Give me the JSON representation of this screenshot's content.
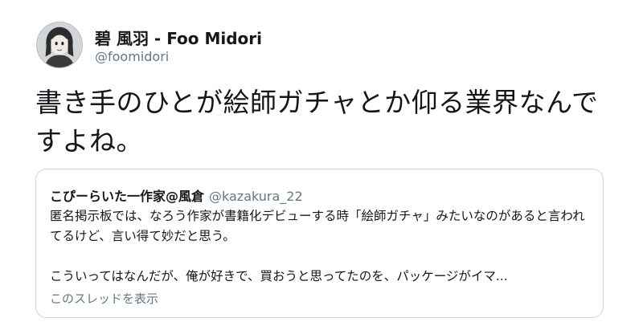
{
  "author": {
    "display_name": "碧 風羽 - Foo Midori",
    "handle": "@foomidori"
  },
  "tweet": {
    "text": "書き手のひとが絵師ガチャとか仰る業界なんですよね。"
  },
  "quoted_tweet": {
    "name": "こぴーらいた一作家@風倉",
    "handle": "@kazakura_22",
    "paragraph_1": "匿名掲示板では、なろう作家が書籍化デビューする時「絵師ガチャ」みたいなのがあると言われてるけど、言い得て妙だと思う。",
    "paragraph_2": "こういってはなんだが、俺が好きで、買おうと思ってたのを、パッケージがイマ...",
    "show_thread_label": "このスレッドを表示"
  }
}
